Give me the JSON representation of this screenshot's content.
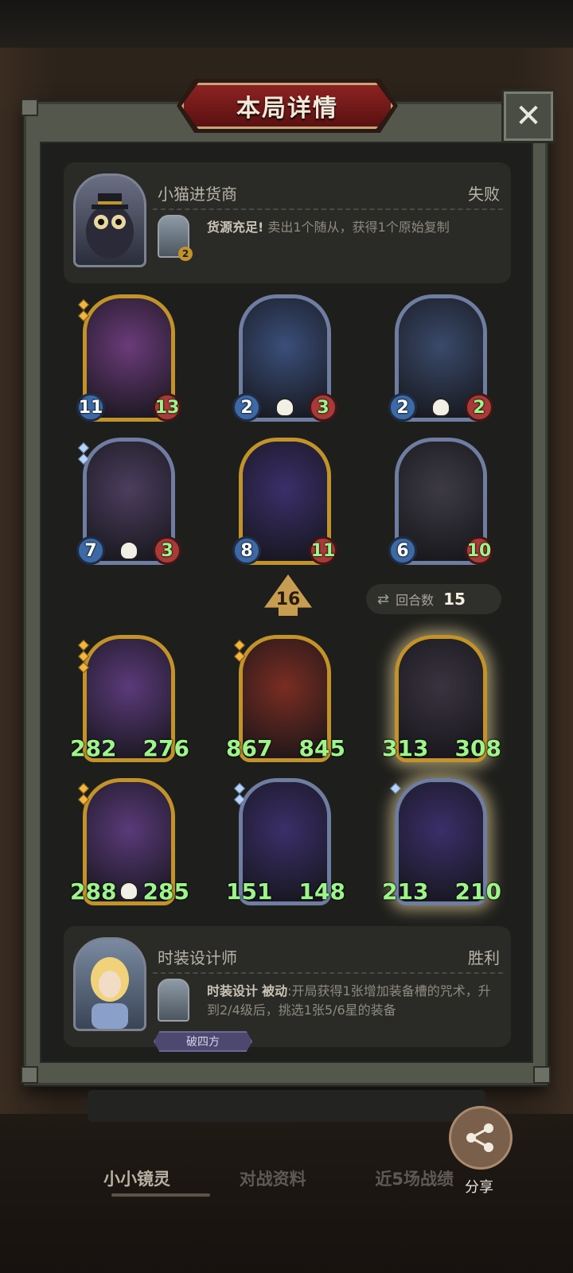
{
  "title": "本局详情",
  "close_label": "✕",
  "opponent": {
    "name": "小猫进货商",
    "result": "失败",
    "skill_name": "货源充足!",
    "skill_desc": "卖出1个随从，获得1个原始复制",
    "skill_badge": "2"
  },
  "opponent_units": [
    {
      "atk": "11",
      "hp": "13",
      "frame": "gold",
      "stars": 2,
      "art": "#6b3b7a"
    },
    {
      "atk": "2",
      "hp": "3",
      "frame": "silver",
      "stars": 0,
      "art": "#3b4f7a",
      "skull": true
    },
    {
      "atk": "2",
      "hp": "2",
      "frame": "silver",
      "stars": 0,
      "art": "#3a4a6a",
      "skull": true
    },
    {
      "atk": "7",
      "hp": "3",
      "frame": "silver",
      "stars": 2,
      "art": "#4b3e5e",
      "skull": true,
      "diamond": true
    },
    {
      "atk": "8",
      "hp": "11",
      "frame": "gold",
      "stars": 0,
      "art": "#3b2f6a"
    },
    {
      "atk": "6",
      "hp": "10",
      "frame": "silver",
      "stars": 0,
      "art": "#3d3a44"
    }
  ],
  "level": "16",
  "rounds": {
    "label": "回合数",
    "value": "15",
    "icon": "swap-icon"
  },
  "player_units": [
    {
      "atk": "282",
      "hp": "276",
      "frame": "gold",
      "stars": 3,
      "art": "#5b3a7a"
    },
    {
      "atk": "867",
      "hp": "845",
      "frame": "gold",
      "stars": 2,
      "art": "#7a2d22"
    },
    {
      "atk": "313",
      "hp": "308",
      "frame": "gold",
      "stars": 0,
      "art": "#3a3340",
      "glow": true
    },
    {
      "atk": "288",
      "hp": "285",
      "frame": "gold",
      "stars": 2,
      "art": "#5a3a7a",
      "skull": true
    },
    {
      "atk": "151",
      "hp": "148",
      "frame": "silver",
      "stars": 2,
      "art": "#3b2f6a",
      "diamond": true
    },
    {
      "atk": "213",
      "hp": "210",
      "frame": "silver",
      "stars": 1,
      "art": "#3b2f6a",
      "glow": true,
      "diamond": true
    }
  ],
  "player": {
    "name": "时装设计师",
    "result": "胜利",
    "skill_name": "时装设计",
    "skill_type": "被动",
    "skill_desc": ":开局获得1张增加装备槽的咒术，升到2/4级后，挑选1张5/6星的装备",
    "tag": "破四方"
  },
  "tabs": [
    "小小镜灵",
    "对战资料",
    "近5场战绩"
  ],
  "share_label": "分享",
  "colors": {
    "accent_gold": "#c2932a",
    "hp_green": "#9df58a",
    "banner_red": "#8c2222"
  }
}
